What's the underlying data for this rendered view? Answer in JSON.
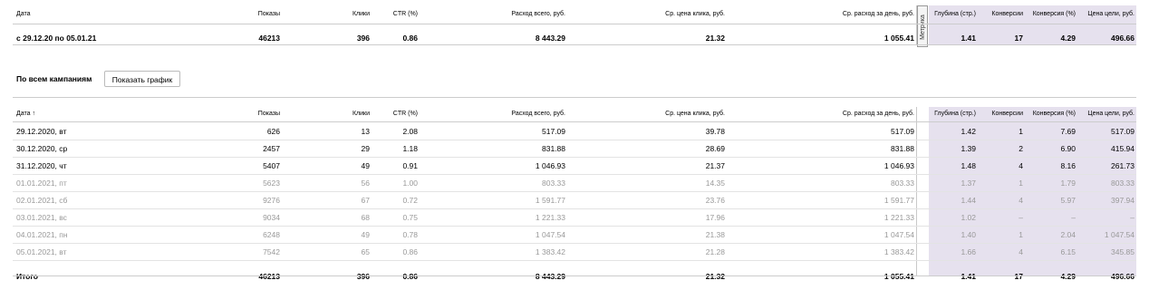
{
  "columns": [
    "Дата",
    "Показы",
    "Клики",
    "CTR (%)",
    "Расход всего, руб.",
    "Ср. цена клика, руб.",
    "Ср. расход за день, руб.",
    "Глубина (стр.)",
    "Конверсии",
    "Конверсия (%)",
    "Цена цели, руб."
  ],
  "columns_sorted": [
    "Дата ↑",
    "Показы",
    "Клики",
    "CTR (%)",
    "Расход всего, руб.",
    "Ср. цена клика, руб.",
    "Ср. расход за день, руб.",
    "Глубина (стр.)",
    "Конверсии",
    "Конверсия (%)",
    "Цена цели, руб."
  ],
  "metrika_tab": "Метрика",
  "summary": [
    "с 29.12.20 по 05.01.21",
    "46213",
    "396",
    "0.86",
    "8 443.29",
    "21.32",
    "1 055.41",
    "1.41",
    "17",
    "4.29",
    "496.66"
  ],
  "section_title": "По всем кампаниям",
  "show_chart_button": "Показать график",
  "rows": [
    {
      "cells": [
        "29.12.2020, вт",
        "626",
        "13",
        "2.08",
        "517.09",
        "39.78",
        "517.09",
        "1.42",
        "1",
        "7.69",
        "517.09"
      ],
      "muted": false
    },
    {
      "cells": [
        "30.12.2020, ср",
        "2457",
        "29",
        "1.18",
        "831.88",
        "28.69",
        "831.88",
        "1.39",
        "2",
        "6.90",
        "415.94"
      ],
      "muted": false
    },
    {
      "cells": [
        "31.12.2020, чт",
        "5407",
        "49",
        "0.91",
        "1 046.93",
        "21.37",
        "1 046.93",
        "1.48",
        "4",
        "8.16",
        "261.73"
      ],
      "muted": false
    },
    {
      "cells": [
        "01.01.2021, пт",
        "5623",
        "56",
        "1.00",
        "803.33",
        "14.35",
        "803.33",
        "1.37",
        "1",
        "1.79",
        "803.33"
      ],
      "muted": true
    },
    {
      "cells": [
        "02.01.2021, сб",
        "9276",
        "67",
        "0.72",
        "1 591.77",
        "23.76",
        "1 591.77",
        "1.44",
        "4",
        "5.97",
        "397.94"
      ],
      "muted": true
    },
    {
      "cells": [
        "03.01.2021, вс",
        "9034",
        "68",
        "0.75",
        "1 221.33",
        "17.96",
        "1 221.33",
        "1.02",
        "–",
        "–",
        "–"
      ],
      "muted": true
    },
    {
      "cells": [
        "04.01.2021, пн",
        "6248",
        "49",
        "0.78",
        "1 047.54",
        "21.38",
        "1 047.54",
        "1.40",
        "1",
        "2.04",
        "1 047.54"
      ],
      "muted": true
    },
    {
      "cells": [
        "05.01.2021, вт",
        "7542",
        "65",
        "0.86",
        "1 383.42",
        "21.28",
        "1 383.42",
        "1.66",
        "4",
        "6.15",
        "345.85"
      ],
      "muted": true
    }
  ],
  "total": [
    "Итого",
    "46213",
    "396",
    "0.86",
    "8 443.29",
    "21.32",
    "1 055.41",
    "1.41",
    "17",
    "4.29",
    "496.66"
  ]
}
